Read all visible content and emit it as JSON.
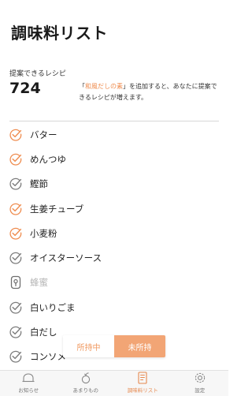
{
  "header": {
    "title": "調味料リスト"
  },
  "summary": {
    "label": "提案できるレシピ",
    "count": "724",
    "hint_prefix": "「",
    "hint_highlight": "和風だしの素",
    "hint_suffix": "」を追加すると、あなたに提案できるレシピが増えます。"
  },
  "colors": {
    "accent": "#ef8d50",
    "muted": "#7d7d7d",
    "locked": "#b4b4b4"
  },
  "items": [
    {
      "label": "バター",
      "state": "owned-accent"
    },
    {
      "label": "めんつゆ",
      "state": "owned-accent"
    },
    {
      "label": "鰹節",
      "state": "owned-gray"
    },
    {
      "label": "生姜チューブ",
      "state": "owned-accent"
    },
    {
      "label": "小麦粉",
      "state": "owned-accent"
    },
    {
      "label": "オイスターソース",
      "state": "owned-gray"
    },
    {
      "label": "蜂蜜",
      "state": "locked"
    },
    {
      "label": "白いりごま",
      "state": "owned-gray"
    },
    {
      "label": "白だし",
      "state": "owned-gray"
    },
    {
      "label": "コンソメ",
      "state": "owned-gray"
    }
  ],
  "filter": {
    "owned": "所持中",
    "not_owned": "未所持"
  },
  "tabs": [
    {
      "label": "お知らせ",
      "icon": "bell-icon"
    },
    {
      "label": "あまりもの",
      "icon": "leftover-icon"
    },
    {
      "label": "調味料リスト",
      "icon": "list-icon"
    },
    {
      "label": "設定",
      "icon": "gear-icon"
    }
  ]
}
